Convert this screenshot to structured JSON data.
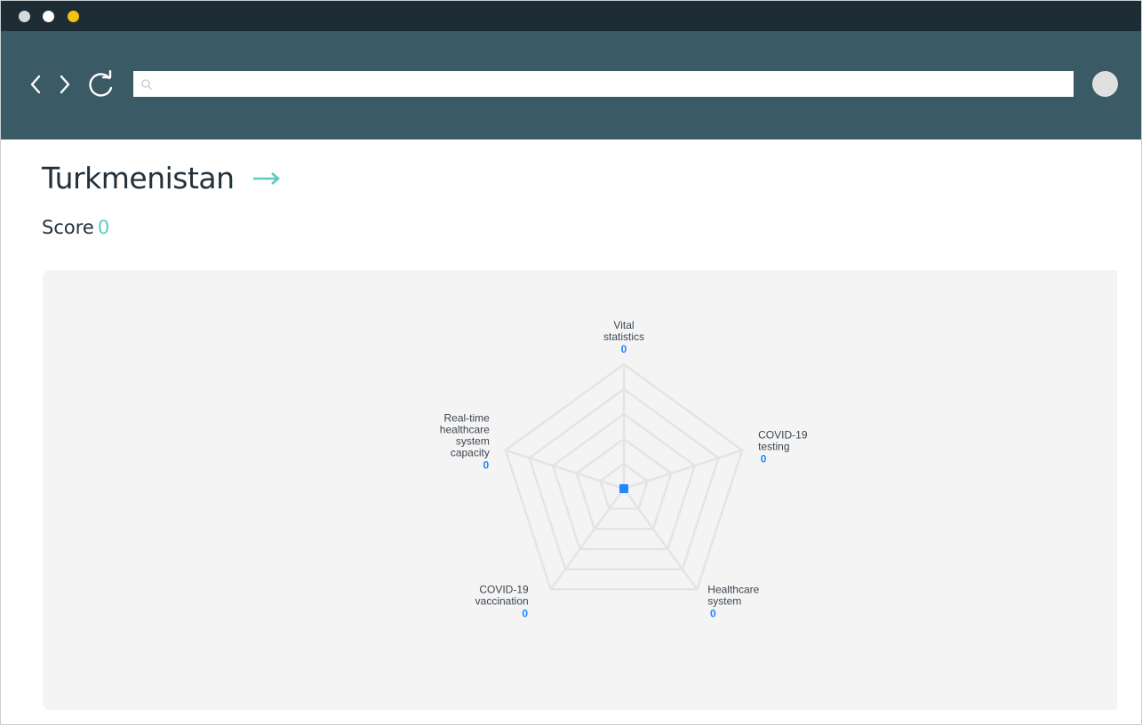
{
  "window": {
    "controls": [
      "close",
      "minimize",
      "maximize"
    ],
    "control_colors": {
      "close": "#d9d9d9",
      "minimize": "#ffffff",
      "maximize": "#f2c40f"
    }
  },
  "toolbar": {
    "back_icon": "chevron-left-icon",
    "forward_icon": "chevron-right-icon",
    "reload_icon": "reload-icon",
    "address_value": "",
    "address_placeholder": "",
    "search_icon": "search-icon",
    "profile_icon": "avatar"
  },
  "page": {
    "title": "Turkmenistan",
    "link_icon": "arrow-right-icon",
    "score_label": "Score",
    "score_value": "0",
    "accent_color": "#5fc9c2"
  },
  "chart_data": {
    "type": "radar",
    "axes": [
      {
        "label": [
          "Vital",
          "statistics"
        ],
        "value": 0
      },
      {
        "label": [
          "COVID-19",
          "testing"
        ],
        "value": 0
      },
      {
        "label": [
          "Healthcare",
          "system"
        ],
        "value": 0
      },
      {
        "label": [
          "COVID-19",
          "vaccination"
        ],
        "value": 0
      },
      {
        "label": [
          "Real-time",
          "healthcare",
          "system",
          "capacity"
        ],
        "value": 0
      }
    ],
    "value_range": [
      0,
      5
    ],
    "rings": 5,
    "grid": true,
    "series_color": "#1e88ff",
    "grid_color": "#e4e4e4"
  }
}
